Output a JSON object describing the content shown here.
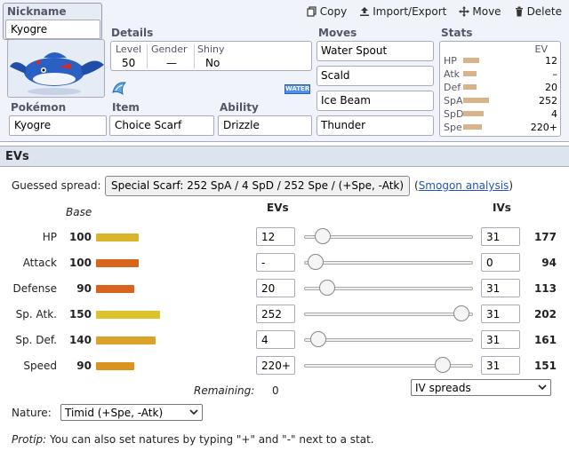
{
  "toolbar": {
    "copy_label": "Copy",
    "import_export_label": "Import/Export",
    "move_label": "Move",
    "delete_label": "Delete"
  },
  "nickname": {
    "label": "Nickname",
    "value": "Kyogre"
  },
  "details": {
    "label": "Details",
    "level_label": "Level",
    "level_value": "50",
    "gender_label": "Gender",
    "gender_value": "—",
    "shiny_label": "Shiny",
    "shiny_value": "No"
  },
  "type_badge": "WATER",
  "pokemon": {
    "label": "Pokémon",
    "value": "Kyogre"
  },
  "item": {
    "label": "Item",
    "value": "Choice Scarf"
  },
  "ability": {
    "label": "Ability",
    "value": "Drizzle"
  },
  "moves": {
    "label": "Moves",
    "items": [
      "Water Spout",
      "Scald",
      "Ice Beam",
      "Thunder"
    ]
  },
  "stats": {
    "label": "Stats",
    "ev_header": "EV",
    "rows": [
      {
        "name": "HP",
        "ev": "12",
        "fill": 0.33
      },
      {
        "name": "Atk",
        "ev": "–",
        "fill": 0.27
      },
      {
        "name": "Def",
        "ev": "20",
        "fill": 0.27
      },
      {
        "name": "SpA",
        "ev": "252",
        "fill": 0.52
      },
      {
        "name": "SpD",
        "ev": "4",
        "fill": 0.41
      },
      {
        "name": "Spe",
        "ev": "220+",
        "fill": 0.39
      }
    ]
  },
  "evs": {
    "title": "EVs",
    "guessed_label": "Guessed spread:",
    "guessed_value": "Special Scarf: 252 SpA / 4 SpD / 252 Spe / (+Spe, -Atk)",
    "paren_open": "(",
    "smogon_link": "Smogon analysis",
    "paren_close": ")",
    "base_header": "Base",
    "evs_header": "EVs",
    "ivs_header": "IVs",
    "rows": [
      {
        "label": "HP",
        "base": "100",
        "base_num": 100,
        "bar_color": "#d8b52a",
        "ev": "12",
        "ev_num": 12,
        "iv": "31",
        "total": "177"
      },
      {
        "label": "Attack",
        "base": "100",
        "base_num": 100,
        "bar_color": "#d9641d",
        "ev": "-",
        "ev_num": 0,
        "iv": "0",
        "total": "94"
      },
      {
        "label": "Defense",
        "base": "90",
        "base_num": 90,
        "bar_color": "#d9641d",
        "ev": "20",
        "ev_num": 20,
        "iv": "31",
        "total": "113"
      },
      {
        "label": "Sp. Atk.",
        "base": "150",
        "base_num": 150,
        "bar_color": "#dcc22c",
        "ev": "252",
        "ev_num": 252,
        "iv": "31",
        "total": "202"
      },
      {
        "label": "Sp. Def.",
        "base": "140",
        "base_num": 140,
        "bar_color": "#dba22a",
        "ev": "4",
        "ev_num": 4,
        "iv": "31",
        "total": "161"
      },
      {
        "label": "Speed",
        "base": "90",
        "base_num": 90,
        "bar_color": "#d9941f",
        "ev": "220+",
        "ev_num": 220,
        "iv": "31",
        "total": "151"
      }
    ],
    "remaining_label": "Remaining:",
    "remaining_value": "0",
    "iv_spreads_selected": "IV spreads",
    "nature_label": "Nature:",
    "nature_selected": "Timid (+Spe, -Atk)",
    "protip_label": "Protip:",
    "protip_text": "You can also set natures by typing \"+\" and \"-\" next to a stat."
  },
  "colors": {
    "panel_bg": "#f0f4fa",
    "header_bg": "#dde4ee",
    "link": "#2255bb",
    "stat_bar": "#d9b48a"
  }
}
